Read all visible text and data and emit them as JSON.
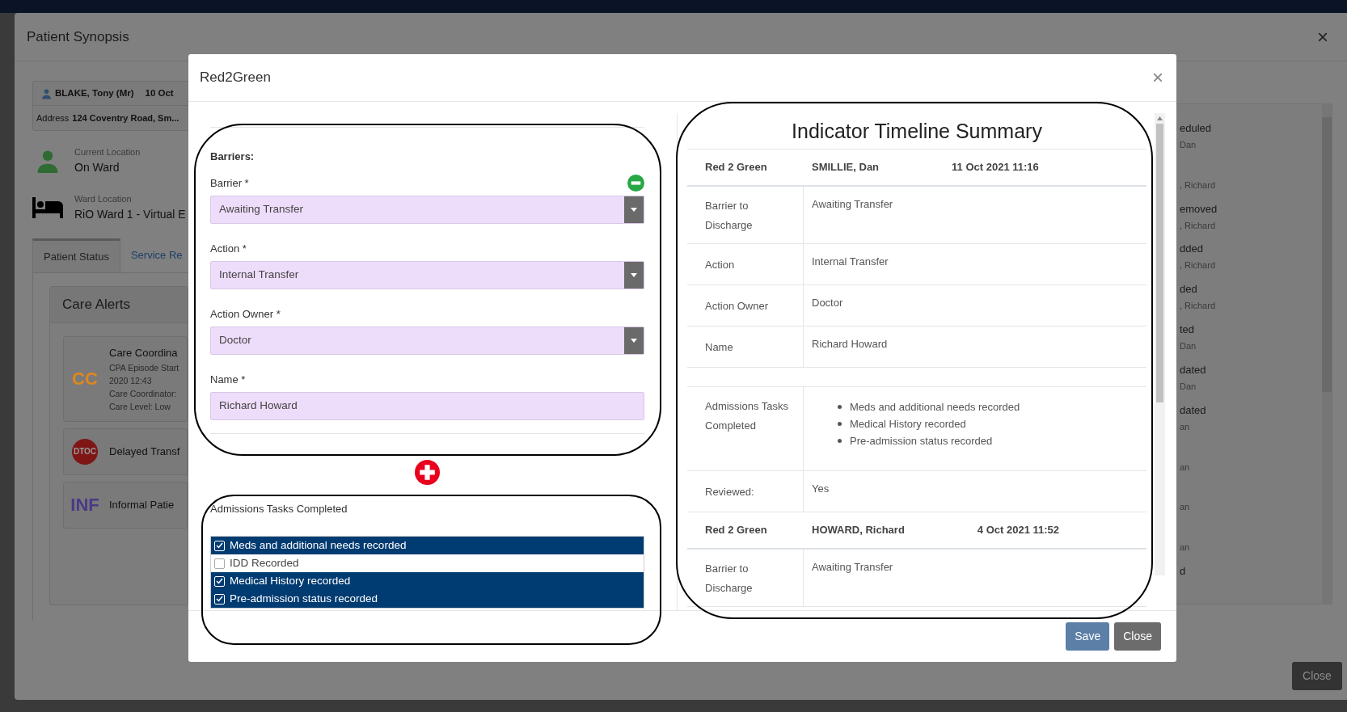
{
  "background_window": {
    "title": "Patient Synopsis",
    "close": "×",
    "patient_banner": {
      "name": "BLAKE, Tony (Mr)",
      "date": "10 Oct",
      "address_label": "Address",
      "address": "124 Coventry Road, Sm..."
    },
    "locations": [
      {
        "kind": "person",
        "label": "Current Location",
        "value": "On Ward"
      },
      {
        "kind": "bed",
        "label": "Ward Location",
        "value": "RiO Ward 1 - Virtual E"
      }
    ],
    "tabs": [
      {
        "label": "Patient Status",
        "selected": true
      },
      {
        "label": "Service Re",
        "selected": false
      }
    ],
    "care_alerts": {
      "title": "Care Alerts",
      "items": [
        {
          "kind": "text",
          "badge": "CC",
          "color": "#e0871c",
          "title": "Care Coordina",
          "details": [
            "CPA Episode Start",
            "2020 12:43",
            "Care Coordinator:",
            "Care Level: Low"
          ]
        },
        {
          "kind": "circle",
          "badge": "DTOC",
          "color": "#7f1616",
          "title": "Delayed Transf"
        },
        {
          "kind": "text",
          "badge": "INF",
          "color": "#4a3a86",
          "title": "Informal Patie"
        }
      ]
    },
    "activity_list": [
      {
        "title": "eduled",
        "subtitle": "Dan"
      },
      {
        "subtitle": ", Richard"
      },
      {
        "title": "emoved",
        "subtitle": ", Richard"
      },
      {
        "title": "dded",
        "subtitle": ", Richard"
      },
      {
        "title": "ded",
        "subtitle": ", Richard"
      },
      {
        "title": "ted",
        "subtitle": "Dan"
      },
      {
        "title": "dated",
        "subtitle": "Dan"
      },
      {
        "title": "dated",
        "subtitle": "an"
      },
      {
        "subtitle": "an"
      },
      {
        "subtitle": "an"
      },
      {
        "subtitle": "an"
      },
      {
        "title": "d"
      }
    ],
    "close_button": "Close"
  },
  "modal": {
    "title": "Red2Green",
    "close": "×",
    "barriers_heading": "Barriers:",
    "fields": [
      {
        "kind": "select",
        "label": "Barrier *",
        "value": "Awaiting Transfer"
      },
      {
        "kind": "select",
        "label": "Action *",
        "value": "Internal Transfer"
      },
      {
        "kind": "select",
        "label": "Action Owner *",
        "value": "Doctor"
      },
      {
        "kind": "text",
        "label": "Name *",
        "value": "Richard Howard"
      }
    ],
    "tasks": {
      "label": "Admissions Tasks Completed",
      "items": [
        {
          "label": "Meds and additional needs recorded",
          "checked": true
        },
        {
          "label": "IDD Recorded",
          "checked": false
        },
        {
          "label": "Medical History recorded",
          "checked": true
        },
        {
          "label": "Pre-admission status recorded",
          "checked": true
        }
      ]
    },
    "summary": {
      "title": "Indicator Timeline Summary",
      "entries": [
        {
          "type": "Red 2 Green",
          "author": "SMILLIE, Dan",
          "date": "11 Oct 2021 11:16",
          "rows": [
            {
              "kind": "text",
              "label": "Barrier to Discharge",
              "value": "Awaiting Transfer"
            },
            {
              "kind": "text",
              "label": "Action",
              "value": "Internal Transfer"
            },
            {
              "kind": "text",
              "label": "Action Owner",
              "value": "Doctor"
            },
            {
              "kind": "text",
              "label": "Name",
              "value": "Richard Howard"
            },
            {
              "kind": "spacer"
            },
            {
              "kind": "list",
              "label": "Admissions Tasks Completed",
              "items": [
                "Meds and additional needs recorded",
                "Medical History recorded",
                "Pre-admission status recorded"
              ]
            },
            {
              "kind": "text",
              "label": "Reviewed:",
              "value": "Yes"
            }
          ]
        },
        {
          "type": "Red 2 Green",
          "author": "HOWARD, Richard",
          "date": "4 Oct 2021 11:52",
          "rows": [
            {
              "kind": "text",
              "label": "Barrier to Discharge",
              "value": "Awaiting Transfer"
            }
          ]
        }
      ]
    },
    "buttons": [
      {
        "kind": "primary",
        "label": "Save"
      },
      {
        "kind": "secondary",
        "label": "Close"
      }
    ]
  }
}
